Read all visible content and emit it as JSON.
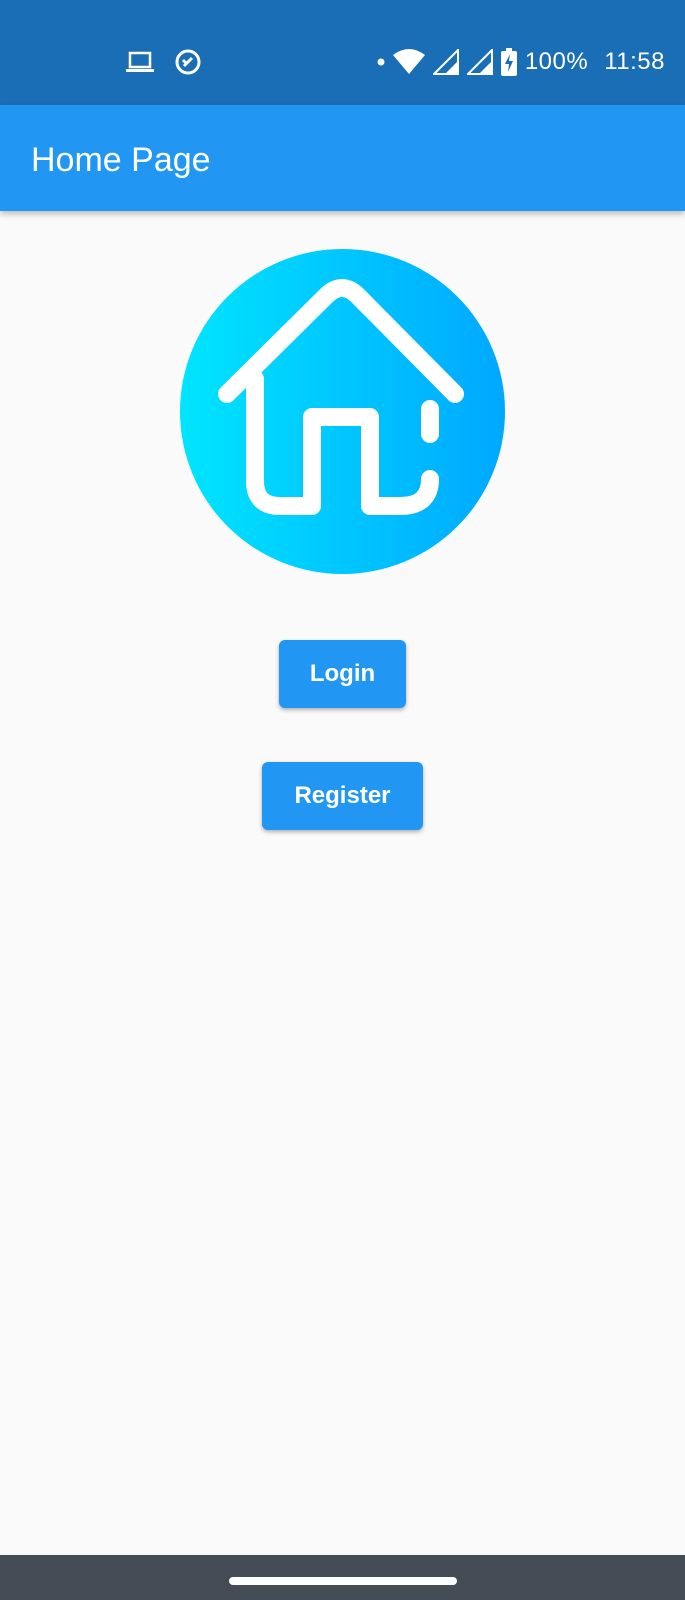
{
  "status_bar": {
    "left_icons": [
      "laptop-icon",
      "do-not-disturb-icon"
    ],
    "right_icons": [
      "dot-icon",
      "wifi-icon",
      "signal-icon",
      "signal-icon",
      "battery-charging-icon"
    ],
    "battery": "100%",
    "time": "11:58"
  },
  "app_bar": {
    "title": "Home Page"
  },
  "logo": {
    "icon": "house-icon",
    "gradient_start": "#00e5ff",
    "gradient_end": "#00a8ff"
  },
  "buttons": {
    "login": "Login",
    "register": "Register"
  },
  "colors": {
    "status_bar": "#1a6eb5",
    "app_bar": "#2196f3",
    "button": "#2196f3",
    "background": "#fafafa",
    "nav_bar": "#444c55"
  }
}
